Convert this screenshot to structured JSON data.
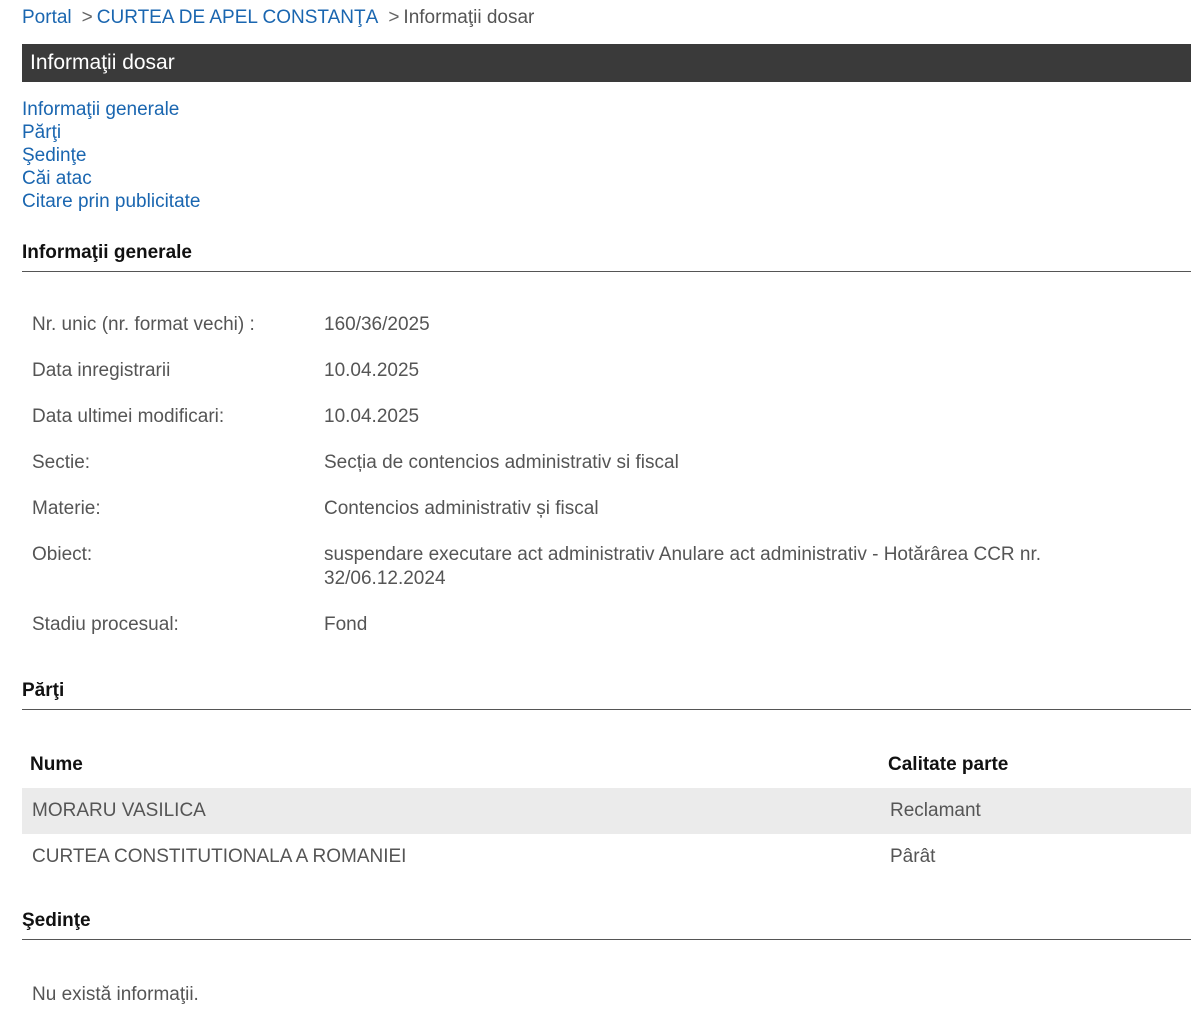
{
  "breadcrumb": {
    "portal": "Portal",
    "sep1": ">",
    "court": "CURTEA DE APEL CONSTANŢA",
    "sep2": ">",
    "current": "Informaţii dosar"
  },
  "page_title": "Informaţii dosar",
  "toc": {
    "general": "Informaţii generale",
    "parti": "Părţi",
    "sedinte": "Şedinţe",
    "cai_atac": "Căi atac",
    "citare": "Citare prin publicitate"
  },
  "general": {
    "heading": "Informaţii generale",
    "rows": [
      {
        "label": "Nr. unic (nr. format vechi) :",
        "value": "160/36/2025"
      },
      {
        "label": "Data inregistrarii",
        "value": "10.04.2025"
      },
      {
        "label": "Data ultimei modificari:",
        "value": "10.04.2025"
      },
      {
        "label": "Sectie:",
        "value": "Secția de contencios administrativ si fiscal"
      },
      {
        "label": "Materie:",
        "value": "Contencios administrativ și fiscal"
      },
      {
        "label": "Obiect:",
        "value": "suspendare executare act administrativ Anulare act administrativ - Hotărârea CCR nr. 32/06.12.2024"
      },
      {
        "label": "Stadiu procesual:",
        "value": "Fond"
      }
    ]
  },
  "parti": {
    "heading": "Părţi",
    "col_nume": "Nume",
    "col_calitate": "Calitate parte",
    "rows": [
      {
        "nume": "MORARU VASILICA",
        "calitate": "Reclamant"
      },
      {
        "nume": "CURTEA CONSTITUTIONALA A ROMANIEI",
        "calitate": "Pârât"
      }
    ]
  },
  "sedinte": {
    "heading": "Şedinţe",
    "empty": "Nu există informaţii."
  },
  "colors": {
    "link": "#1a66b0",
    "title_bar_bg": "#3a3a3a",
    "row_shade": "#ebebeb"
  }
}
